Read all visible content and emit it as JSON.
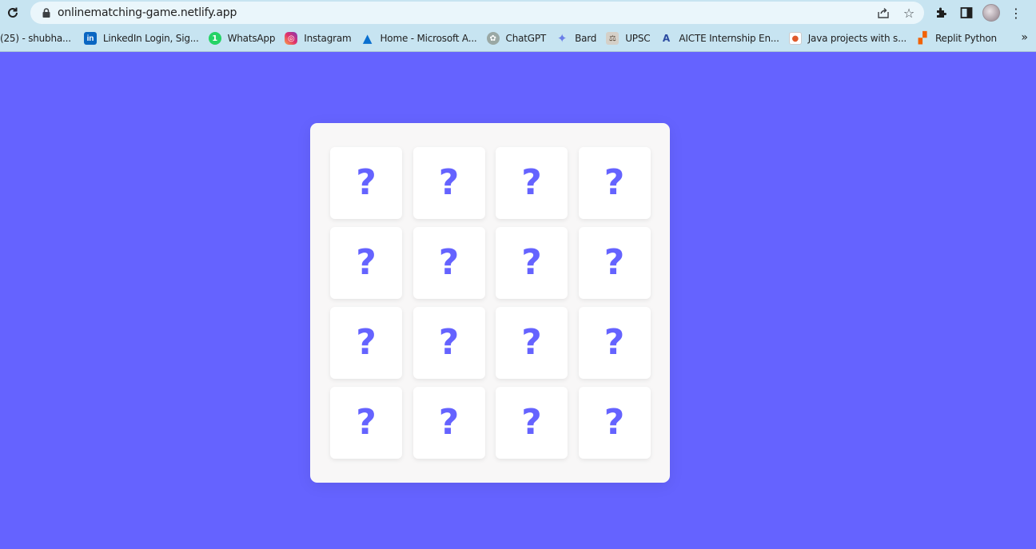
{
  "browser": {
    "url": "onlinematching-game.netlify.app",
    "icons": {
      "reload": "reload-icon",
      "lock": "lock-icon",
      "share": "share-icon",
      "bookmark_star": "star-icon",
      "extensions": "puzzle-icon",
      "side_panel": "side-panel-icon",
      "menu": "kebab-menu-icon"
    },
    "colors": {
      "toolbar": "#c7e4f1",
      "omnibox": "#eaf6fb"
    }
  },
  "bookmarks": [
    {
      "label": "(25) - shubha...",
      "icon": ""
    },
    {
      "label": "LinkedIn Login, Sig...",
      "icon": "linkedin-icon"
    },
    {
      "label": "WhatsApp",
      "icon": "whatsapp-icon"
    },
    {
      "label": "Instagram",
      "icon": "instagram-icon"
    },
    {
      "label": "Home - Microsoft A...",
      "icon": "azure-icon"
    },
    {
      "label": "ChatGPT",
      "icon": "chatgpt-icon"
    },
    {
      "label": "Bard",
      "icon": "bard-icon"
    },
    {
      "label": "UPSC",
      "icon": "upsc-icon"
    },
    {
      "label": "AICTE Internship En...",
      "icon": "aicte-icon"
    },
    {
      "label": "Java projects with s...",
      "icon": "java-icon"
    },
    {
      "label": "Replit Python",
      "icon": "replit-icon"
    }
  ],
  "bookmarks_overflow": "»",
  "game": {
    "background_color": "#6563ff",
    "board_color": "#f8f7f7",
    "card_face_symbol": "?",
    "cards": [
      "?",
      "?",
      "?",
      "?",
      "?",
      "?",
      "?",
      "?",
      "?",
      "?",
      "?",
      "?",
      "?",
      "?",
      "?",
      "?"
    ]
  }
}
